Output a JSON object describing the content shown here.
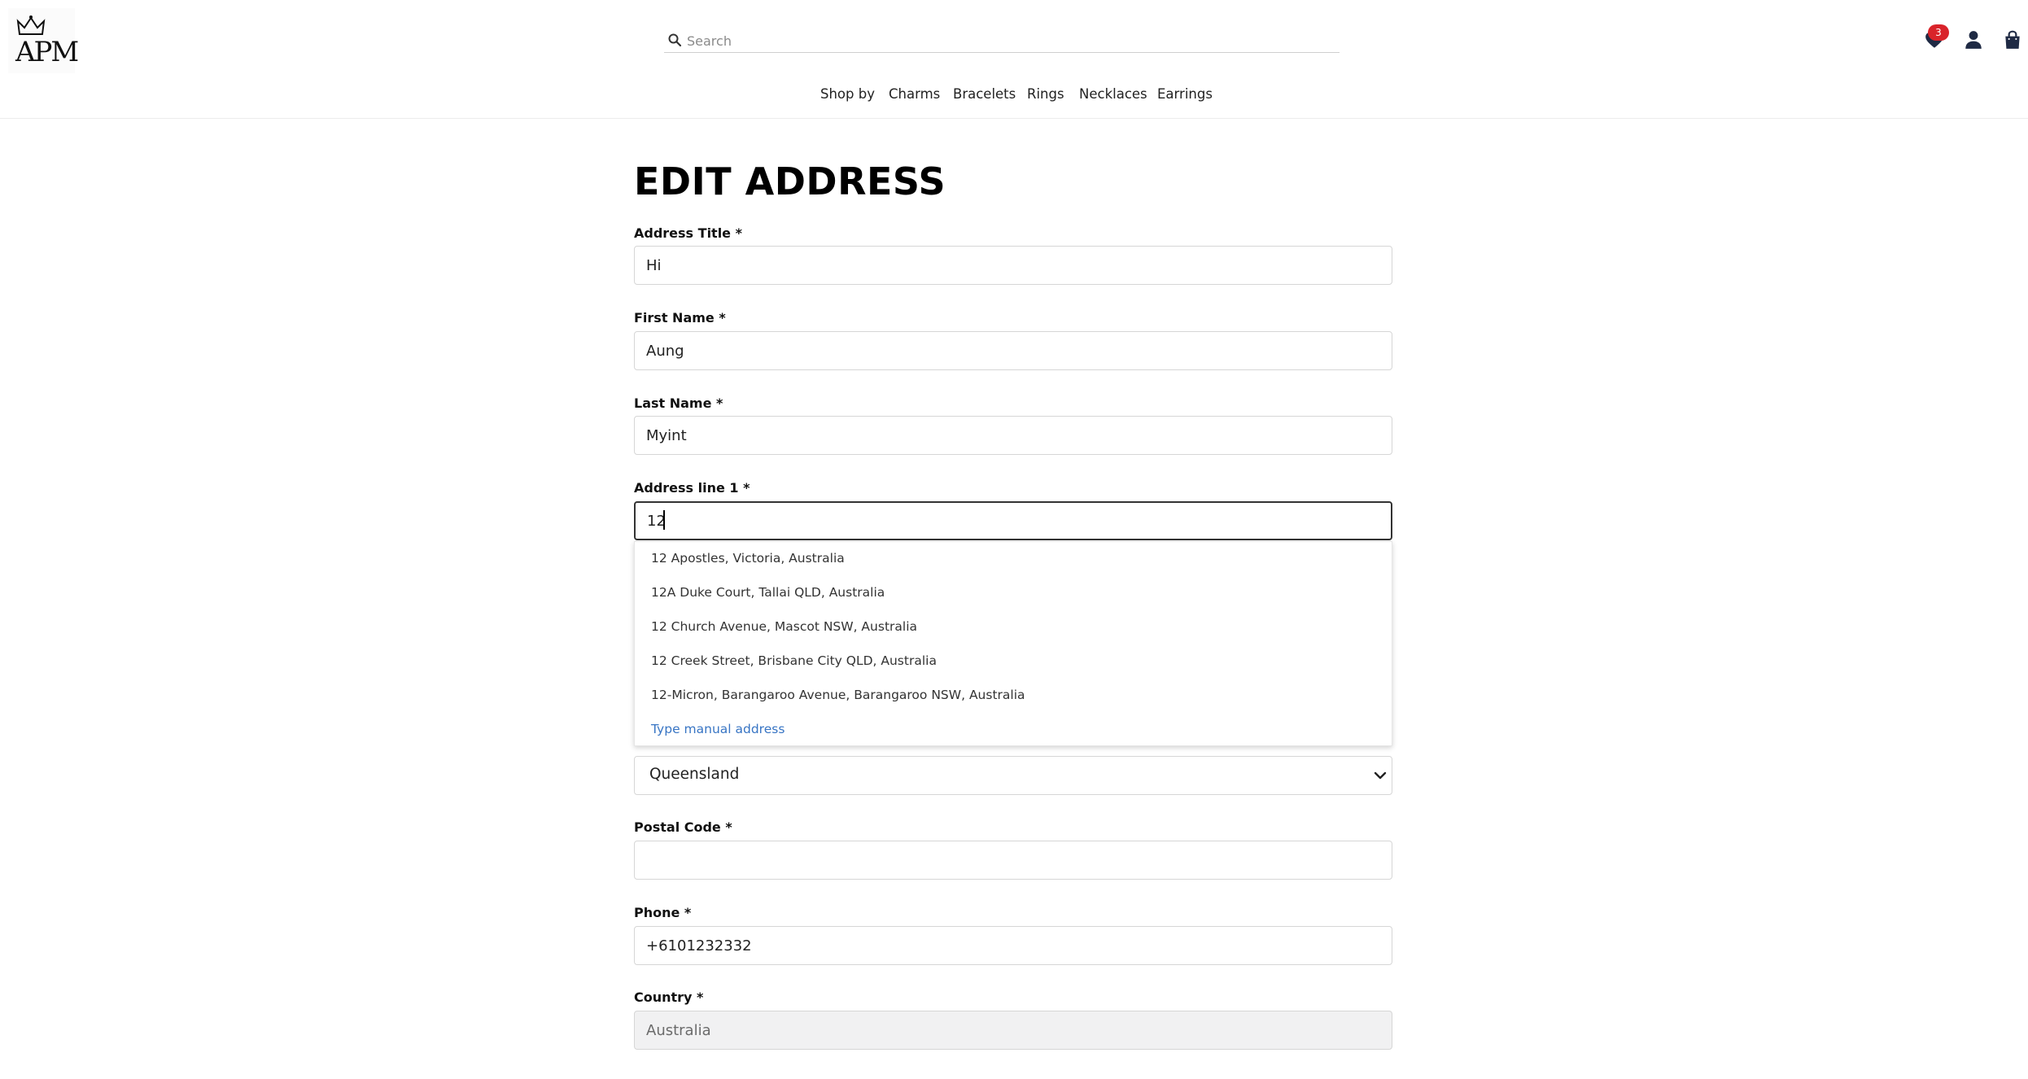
{
  "header": {
    "logo_text": "APM",
    "search": {
      "placeholder": "Search",
      "value": ""
    },
    "nav": [
      "Shop by",
      "Charms",
      "Bracelets",
      "Rings",
      "Necklaces",
      "Earrings"
    ],
    "wishlist_count": "3",
    "icons": [
      "wishlist-heart-icon",
      "user-icon",
      "shopping-bag-icon"
    ]
  },
  "page": {
    "title": "EDIT ADDRESS"
  },
  "form": {
    "address_title": {
      "label": "Address Title *",
      "value": "Hi"
    },
    "first_name": {
      "label": "First Name *",
      "value": "Aung"
    },
    "last_name": {
      "label": "Last Name *",
      "value": "Myint"
    },
    "address_line1": {
      "label": "Address line 1 *",
      "value": "12"
    },
    "state": {
      "selected": "Queensland"
    },
    "postal_code": {
      "label": "Postal Code *",
      "value": ""
    },
    "phone": {
      "label": "Phone *",
      "value": "+6101232332"
    },
    "country": {
      "label": "Country *",
      "value": "Australia"
    }
  },
  "autocomplete": {
    "suggestions": [
      "12 Apostles, Victoria, Australia",
      "12A Duke Court, Tallai QLD, Australia",
      "12 Church Avenue, Mascot NSW, Australia",
      "12 Creek Street, Brisbane City QLD, Australia",
      "12-Micron, Barangaroo Avenue, Barangaroo NSW, Australia"
    ],
    "manual_link": "Type manual address"
  },
  "colors": {
    "badge": "#d9232a",
    "link": "#3875c4",
    "icon": "#1f2a44"
  }
}
